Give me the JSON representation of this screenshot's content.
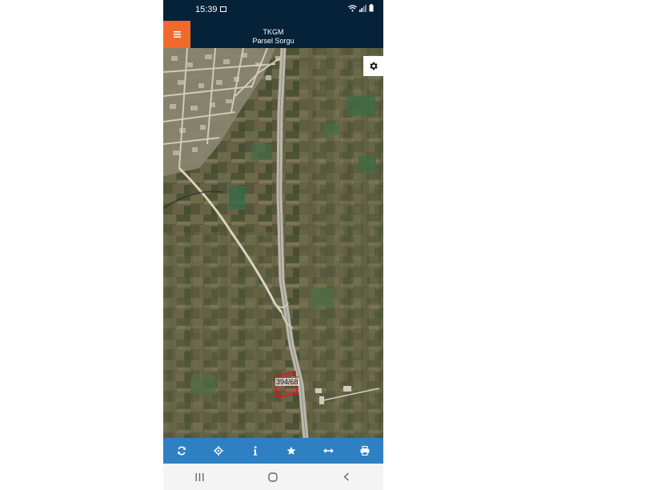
{
  "status_bar": {
    "time": "15:39",
    "icons": [
      "image-icon",
      "wifi-icon",
      "signal-icon",
      "battery-icon"
    ]
  },
  "header": {
    "title": "TKGM",
    "subtitle": "Parsel Sorgu",
    "menu_icon": "hamburger-menu-icon"
  },
  "map": {
    "type": "satellite",
    "parcel_label": "394/68",
    "parcel_color": "#e0141e",
    "settings_icon": "gear-icon"
  },
  "toolbar": {
    "background": "#2f7fc3",
    "buttons": [
      {
        "icon": "refresh-icon"
      },
      {
        "icon": "locate-icon"
      },
      {
        "icon": "info-icon"
      },
      {
        "icon": "star-icon"
      },
      {
        "icon": "measure-icon"
      },
      {
        "icon": "print-icon"
      }
    ]
  },
  "colors": {
    "header_bg": "#062238",
    "menu_accent": "#f26a2b"
  },
  "system_nav": {
    "buttons": [
      "recent-apps-icon",
      "home-icon",
      "back-icon"
    ]
  }
}
